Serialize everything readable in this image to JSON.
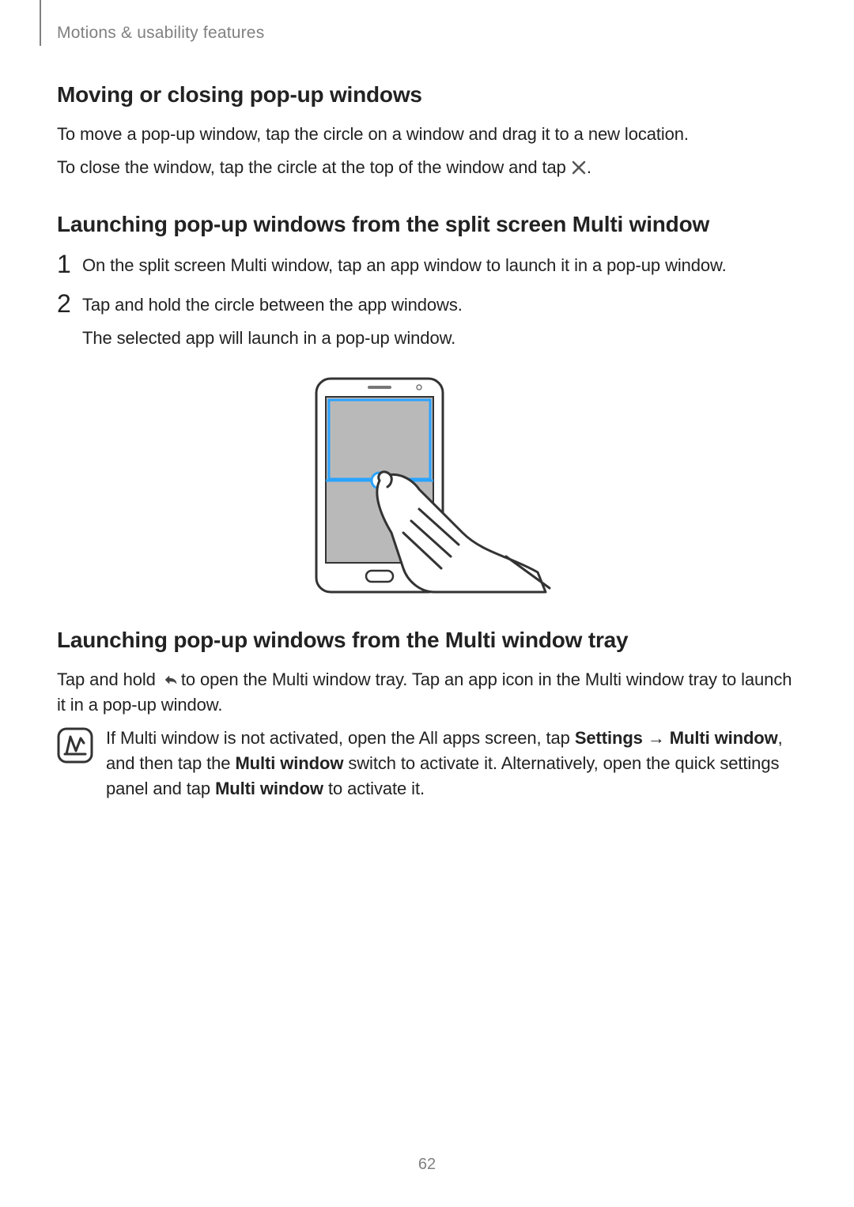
{
  "header": {
    "breadcrumb": "Motions & usability features"
  },
  "section1": {
    "heading": "Moving or closing pop-up windows",
    "p1": "To move a pop-up window, tap the circle on a window and drag it to a new location.",
    "p2_a": "To close the window, tap the circle at the top of the window and tap ",
    "p2_b": "."
  },
  "section2": {
    "heading": "Launching pop-up windows from the split screen Multi window",
    "step1_num": "1",
    "step1_text": "On the split screen Multi window, tap an app window to launch it in a pop-up window.",
    "step2_num": "2",
    "step2_text": "Tap and hold the circle between the app windows.",
    "step2_sub": "The selected app will launch in a pop-up window."
  },
  "section3": {
    "heading": "Launching pop-up windows from the Multi window tray",
    "p1_a": "Tap and hold ",
    "p1_b": " to open the Multi window tray. Tap an app icon in the Multi window tray to launch it in a pop-up window."
  },
  "note": {
    "t1": "If Multi window is not activated, open the All apps screen, tap ",
    "b1": "Settings",
    "arrow": " → ",
    "b2": "Multi window",
    "t2": ", and then tap the ",
    "b3": "Multi window",
    "t3": " switch to activate it. Alternatively, open the quick settings panel and tap ",
    "b4": "Multi window",
    "t4": " to activate it."
  },
  "page_number": "62"
}
